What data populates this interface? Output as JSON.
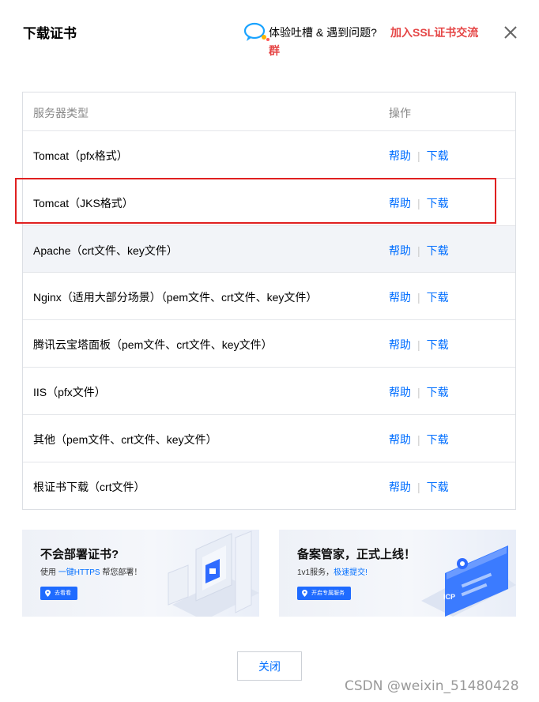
{
  "dialog": {
    "title": "下载证书"
  },
  "feedback": {
    "text": "体验吐槽 & 遇到问题?",
    "link_text_line1": "加入SSL证书交流",
    "link_text_line2": "群"
  },
  "table": {
    "headers": {
      "server_type": "服务器类型",
      "actions": "操作"
    },
    "rows": [
      {
        "name": "Tomcat（pfx格式）",
        "help": "帮助",
        "download": "下载"
      },
      {
        "name": "Tomcat（JKS格式）",
        "help": "帮助",
        "download": "下载"
      },
      {
        "name": "Apache（crt文件、key文件）",
        "help": "帮助",
        "download": "下载"
      },
      {
        "name": "Nginx（适用大部分场景）（pem文件、crt文件、key文件）",
        "help": "帮助",
        "download": "下载"
      },
      {
        "name": "腾讯云宝塔面板（pem文件、crt文件、key文件）",
        "help": "帮助",
        "download": "下载"
      },
      {
        "name": "IIS（pfx文件）",
        "help": "帮助",
        "download": "下载"
      },
      {
        "name": "其他（pem文件、crt文件、key文件）",
        "help": "帮助",
        "download": "下载"
      },
      {
        "name": "根证书下载（crt文件）",
        "help": "帮助",
        "download": "下载"
      }
    ],
    "separator": "|"
  },
  "banners": {
    "left": {
      "title": "不会部署证书?",
      "desc_prefix": "使用",
      "desc_accent": "一键HTTPS",
      "desc_suffix": "帮您部署！",
      "button": "去看看"
    },
    "right": {
      "title": "备案管家，正式上线！",
      "desc_prefix": "1v1服务，",
      "desc_accent": "极速提交!",
      "desc_suffix": "",
      "button": "开启专属服务",
      "icon_text": "ICP"
    }
  },
  "footer": {
    "close_label": "关闭"
  },
  "watermark": "CSDN @weixin_51480428",
  "colors": {
    "accent": "#006eff",
    "danger": "#e54545",
    "highlight": "#e02020"
  }
}
